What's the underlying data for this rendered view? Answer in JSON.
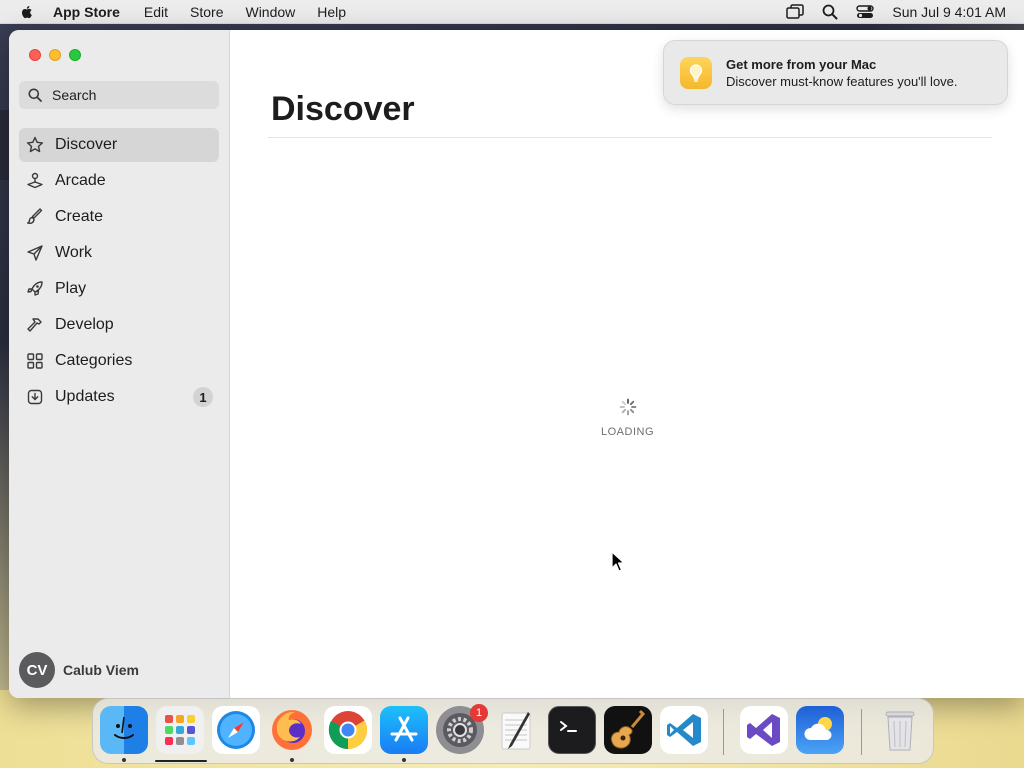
{
  "menubar": {
    "app_name": "App Store",
    "menus": [
      "Edit",
      "Store",
      "Window",
      "Help"
    ],
    "clock": "Sun Jul 9  4:01 AM"
  },
  "sidebar": {
    "search_placeholder": "Search",
    "items": [
      {
        "label": "Discover",
        "icon": "star-icon",
        "active": true
      },
      {
        "label": "Arcade",
        "icon": "joystick-icon"
      },
      {
        "label": "Create",
        "icon": "paintbrush-icon"
      },
      {
        "label": "Work",
        "icon": "paperplane-icon"
      },
      {
        "label": "Play",
        "icon": "rocket-icon"
      },
      {
        "label": "Develop",
        "icon": "hammer-icon"
      },
      {
        "label": "Categories",
        "icon": "grid-icon"
      },
      {
        "label": "Updates",
        "icon": "download-icon",
        "badge": "1"
      }
    ],
    "account": {
      "initials": "CV",
      "name": "Calub Viem"
    }
  },
  "main": {
    "title": "Discover",
    "loading_text": "LOADING"
  },
  "notification": {
    "title": "Get more from your Mac",
    "body": "Discover must-know features you'll love."
  },
  "dock": {
    "apps": [
      "finder-icon",
      "launchpad-icon",
      "safari-icon",
      "firefox-icon",
      "chrome-icon",
      "app-store-icon",
      "system-settings-icon",
      "textedit-icon",
      "terminal-icon",
      "garageband-icon",
      "vscode-icon",
      "visual-studio-icon",
      "weather-icon",
      "trash-icon"
    ],
    "settings_badge": "1"
  },
  "colors": {
    "accent_blue": "#1a7cf5",
    "close": "#fe5f57",
    "minimize": "#febc2e",
    "maximize": "#28c840"
  }
}
